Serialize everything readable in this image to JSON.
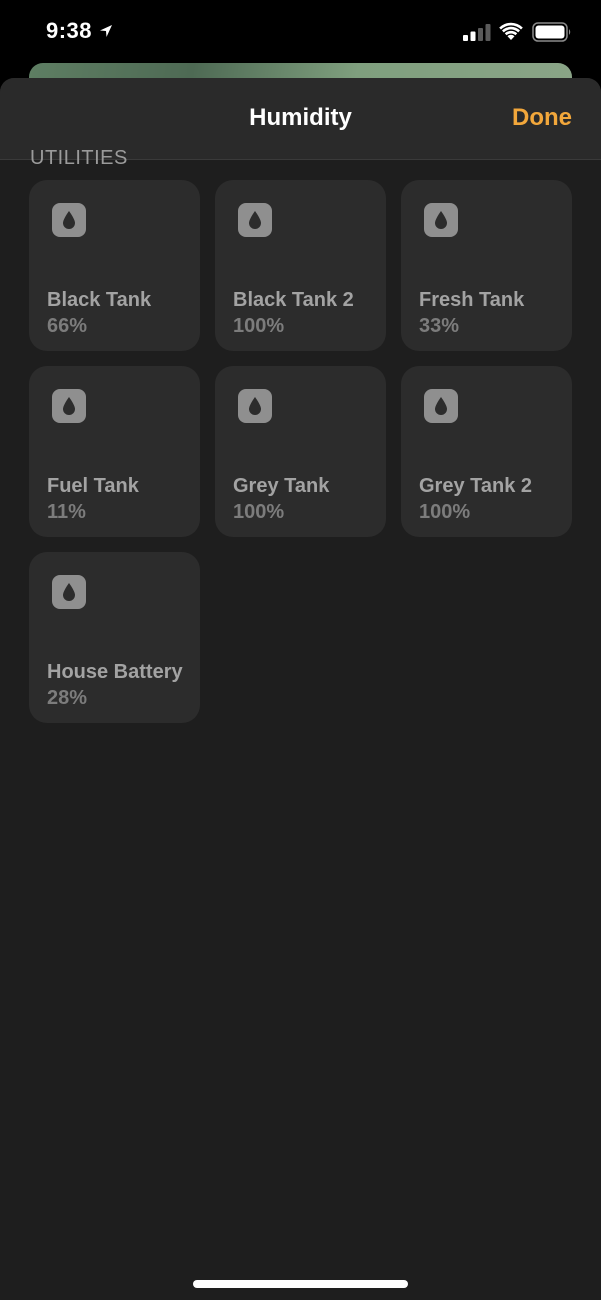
{
  "status_bar": {
    "time": "9:38"
  },
  "sheet": {
    "title": "Humidity",
    "done_label": "Done",
    "accent_color": "#f2a73b"
  },
  "section": {
    "label": "UTILITIES"
  },
  "tiles": [
    {
      "name": "Black Tank",
      "value": "66%",
      "icon": "water-drop-icon"
    },
    {
      "name": "Black Tank 2",
      "value": "100%",
      "icon": "water-drop-icon"
    },
    {
      "name": "Fresh Tank",
      "value": "33%",
      "icon": "water-drop-icon"
    },
    {
      "name": "Fuel Tank",
      "value": "11%",
      "icon": "water-drop-icon"
    },
    {
      "name": "Grey Tank",
      "value": "100%",
      "icon": "water-drop-icon"
    },
    {
      "name": "Grey Tank 2",
      "value": "100%",
      "icon": "water-drop-icon"
    },
    {
      "name": "House Battery",
      "value": "28%",
      "icon": "water-drop-icon"
    }
  ]
}
